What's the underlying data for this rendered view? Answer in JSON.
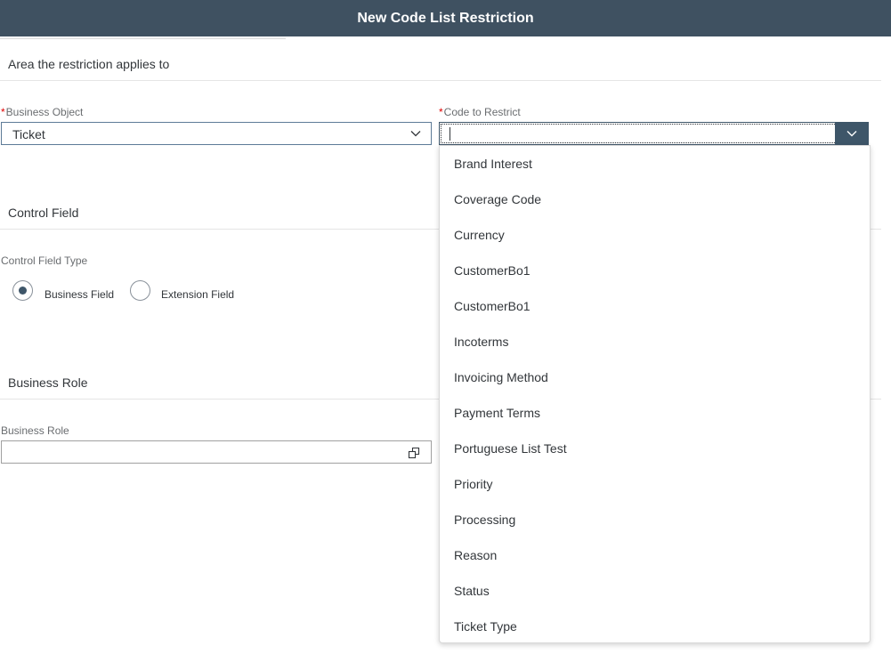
{
  "header": {
    "title": "New Code List Restriction"
  },
  "sections": {
    "area": {
      "title": "Area the restriction applies to"
    },
    "control_field": {
      "title": "Control Field"
    },
    "business_role": {
      "title": "Business Role"
    }
  },
  "business_object": {
    "required_mark": "*",
    "label": "Business Object",
    "value": "Ticket"
  },
  "code_to_restrict": {
    "required_mark": "*",
    "label": "Code to Restrict",
    "value": "",
    "options": [
      "Brand Interest",
      "Coverage Code",
      "Currency",
      "CustomerBo1",
      "CustomerBo1",
      "Incoterms",
      "Invoicing Method",
      "Payment Terms",
      "Portuguese List Test",
      "Priority",
      "Processing",
      "Reason",
      "Status",
      "Ticket Type"
    ]
  },
  "control_field_type": {
    "label": "Control Field Type",
    "options": [
      {
        "label": "Business Field",
        "selected": true
      },
      {
        "label": "Extension Field",
        "selected": false
      }
    ]
  },
  "business_role": {
    "label": "Business Role",
    "value": ""
  },
  "colors": {
    "header_bg": "#3f5161",
    "accent": "#3e5669",
    "required": "#e00000"
  },
  "icons": {
    "select": "chevron-down-icon",
    "value_help": "value-help-icon"
  }
}
